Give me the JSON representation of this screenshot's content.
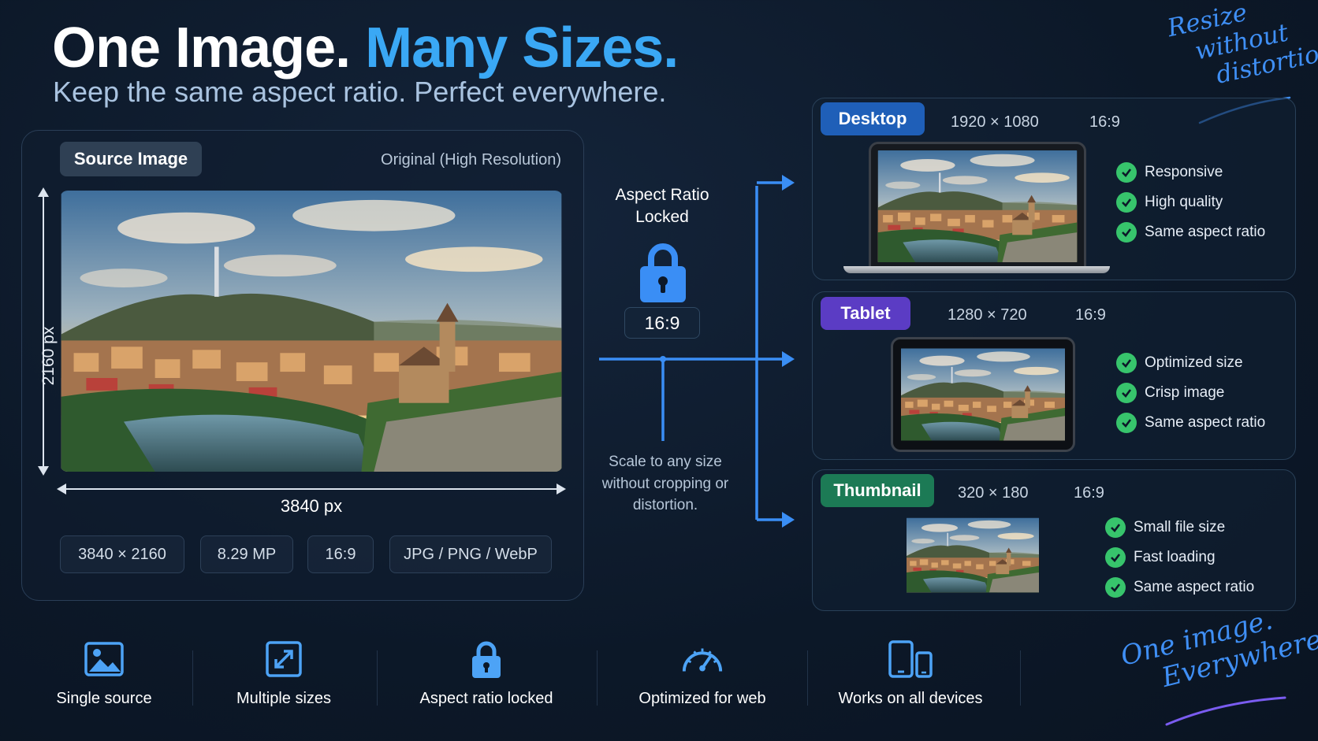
{
  "header": {
    "title_part1": "One Image.",
    "title_part2": "Many Sizes.",
    "subtitle": "Keep the same aspect ratio. Perfect everywhere."
  },
  "top_note": {
    "line1": "Resize",
    "line2": "without",
    "line3": "distortion."
  },
  "source": {
    "badge": "Source Image",
    "note": "Original (High Resolution)",
    "height_label": "2160 px",
    "width_label": "3840 px",
    "chips": [
      "3840 × 2160",
      "8.29 MP",
      "16:9",
      "JPG / PNG / WebP"
    ]
  },
  "middle": {
    "title": "Aspect Ratio Locked",
    "ratio": "16:9",
    "caption": "Scale to any size without cropping or distortion."
  },
  "outputs": [
    {
      "name": "Desktop",
      "size": "1920 × 1080",
      "ratio": "16:9",
      "color": "#1f5fb8",
      "features": [
        "Responsive",
        "High quality",
        "Same aspect ratio"
      ]
    },
    {
      "name": "Tablet",
      "size": "1280 × 720",
      "ratio": "16:9",
      "color": "#5b3cc4",
      "features": [
        "Optimized size",
        "Crisp image",
        "Same aspect ratio"
      ]
    },
    {
      "name": "Thumbnail",
      "size": "320 × 180",
      "ratio": "16:9",
      "color": "#1c7a55",
      "features": [
        "Small file size",
        "Fast loading",
        "Same aspect ratio"
      ]
    }
  ],
  "features": [
    {
      "label": "Single source",
      "icon": "image-icon"
    },
    {
      "label": "Multiple sizes",
      "icon": "expand-icon"
    },
    {
      "label": "Aspect ratio locked",
      "icon": "lock-icon"
    },
    {
      "label": "Optimized for web",
      "icon": "speedometer-icon"
    },
    {
      "label": "Works on all devices",
      "icon": "devices-icon"
    }
  ],
  "bottom_note": {
    "line1": "One image.",
    "line2": "Everywhere."
  },
  "colors": {
    "accent": "#3aa8f5",
    "check": "#37c46c",
    "background": "#0c1828"
  }
}
